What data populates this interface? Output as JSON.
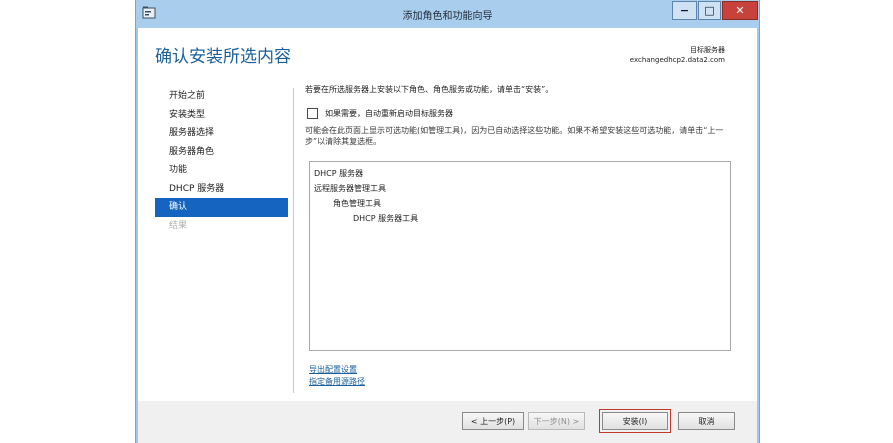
{
  "window": {
    "title": "添加角色和功能向导",
    "minimize_glyph": "−",
    "maximize_glyph": "□",
    "close_glyph": "✕"
  },
  "header": {
    "page_title": "确认安装所选内容",
    "destination_label": "目标服务器",
    "destination_value": "exchangedhcp2.data2.com"
  },
  "sidebar": {
    "items": [
      {
        "label": "开始之前",
        "state": "normal"
      },
      {
        "label": "安装类型",
        "state": "normal"
      },
      {
        "label": "服务器选择",
        "state": "normal"
      },
      {
        "label": "服务器角色",
        "state": "normal"
      },
      {
        "label": "功能",
        "state": "normal"
      },
      {
        "label": "DHCP 服务器",
        "state": "normal"
      },
      {
        "label": "确认",
        "state": "active"
      },
      {
        "label": "结果",
        "state": "disabled"
      }
    ]
  },
  "main": {
    "instruction": "若要在所选服务器上安装以下角色、角色服务或功能，请单击“安装”。",
    "restart_checkbox": {
      "label": "如果需要，自动重新启动目标服务器",
      "checked": false
    },
    "note": "可能会在此页面上显示可选功能(如管理工具)，因为已自动选择这些功能。如果不希望安装这些可选功能，请单击“上一步”以清除其复选框。",
    "features": [
      {
        "label": "DHCP 服务器",
        "level": 0
      },
      {
        "label": "远程服务器管理工具",
        "level": 0
      },
      {
        "label": "角色管理工具",
        "level": 1
      },
      {
        "label": "DHCP 服务器工具",
        "level": 2
      }
    ],
    "links": {
      "export": "导出配置设置",
      "alternate_source": "指定备用源路径"
    }
  },
  "buttons": {
    "previous": "< 上一步(P)",
    "next": "下一步(N) >",
    "install": "安装(I)",
    "cancel": "取消"
  },
  "colors": {
    "accent": "#1565c0",
    "title_blue": "#1a5f9a",
    "window_frame": "#a9cdec",
    "close_red": "#c7423a"
  }
}
